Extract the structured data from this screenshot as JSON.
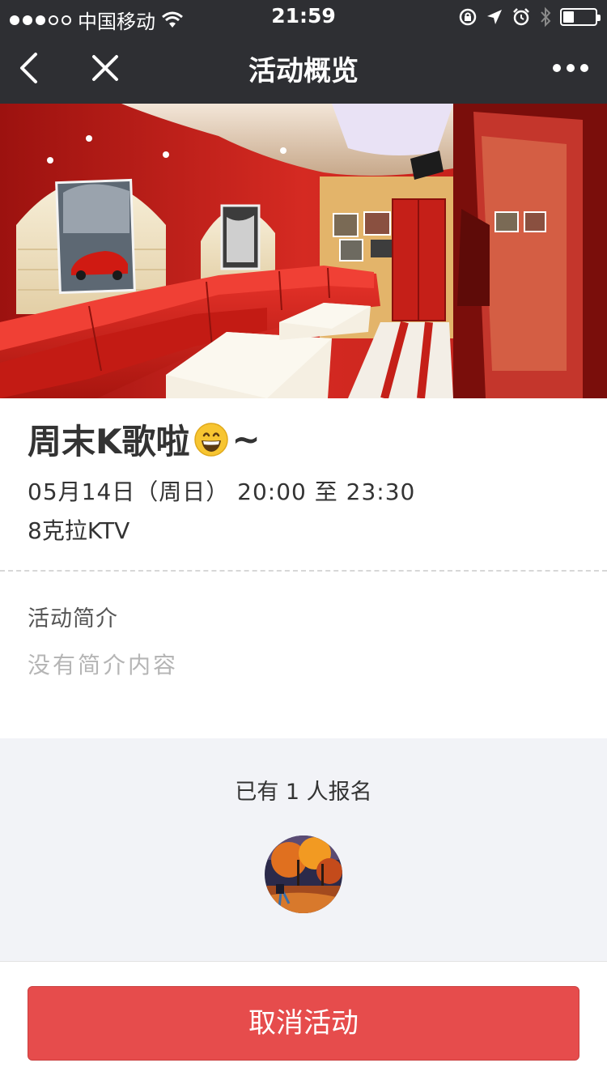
{
  "status_bar": {
    "carrier": "中国移动",
    "time": "21:59"
  },
  "nav": {
    "title": "活动概览",
    "back_icon": "chevron-left-icon",
    "close_icon": "close-icon",
    "more_icon": "more-dots-icon"
  },
  "event": {
    "title": "周末K歌啦",
    "title_suffix": "~",
    "emoji": "grinning-face-emoji",
    "datetime": "05月14日（周日） 20:00 至 23:30",
    "location": "8克拉KTV"
  },
  "intro": {
    "label": "活动简介",
    "content": "没有简介内容"
  },
  "signup": {
    "text": "已有 1 人报名"
  },
  "actions": {
    "cancel_label": "取消活动"
  },
  "colors": {
    "header_bg": "#2e2f33",
    "cancel_button": "#e64c4c",
    "section_bg": "#f2f3f7"
  }
}
